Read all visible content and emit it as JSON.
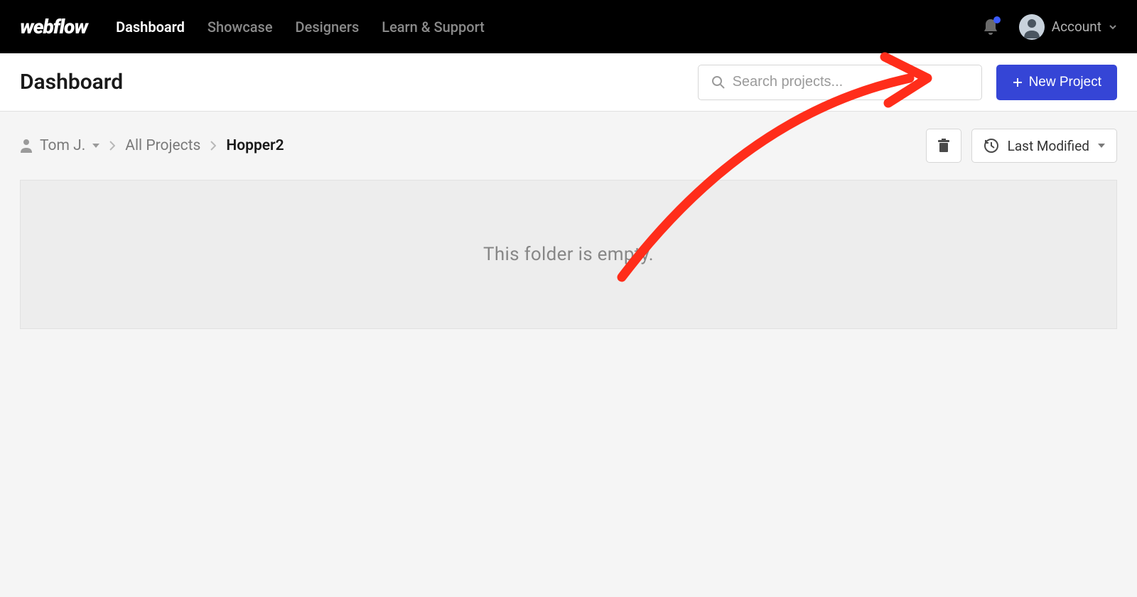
{
  "brand": "webflow",
  "nav": {
    "items": [
      "Dashboard",
      "Showcase",
      "Designers",
      "Learn & Support"
    ],
    "active_index": 0,
    "account_label": "Account"
  },
  "subheader": {
    "title": "Dashboard",
    "search_placeholder": "Search projects...",
    "new_project_label": "New Project"
  },
  "breadcrumb": {
    "user": "Tom J.",
    "items": [
      "All Projects",
      "Hopper2"
    ]
  },
  "toolbar": {
    "sort_label": "Last Modified"
  },
  "main": {
    "empty_message": "This folder is empty."
  },
  "colors": {
    "primary": "#3545d6",
    "annotation": "#ff2d1a"
  }
}
